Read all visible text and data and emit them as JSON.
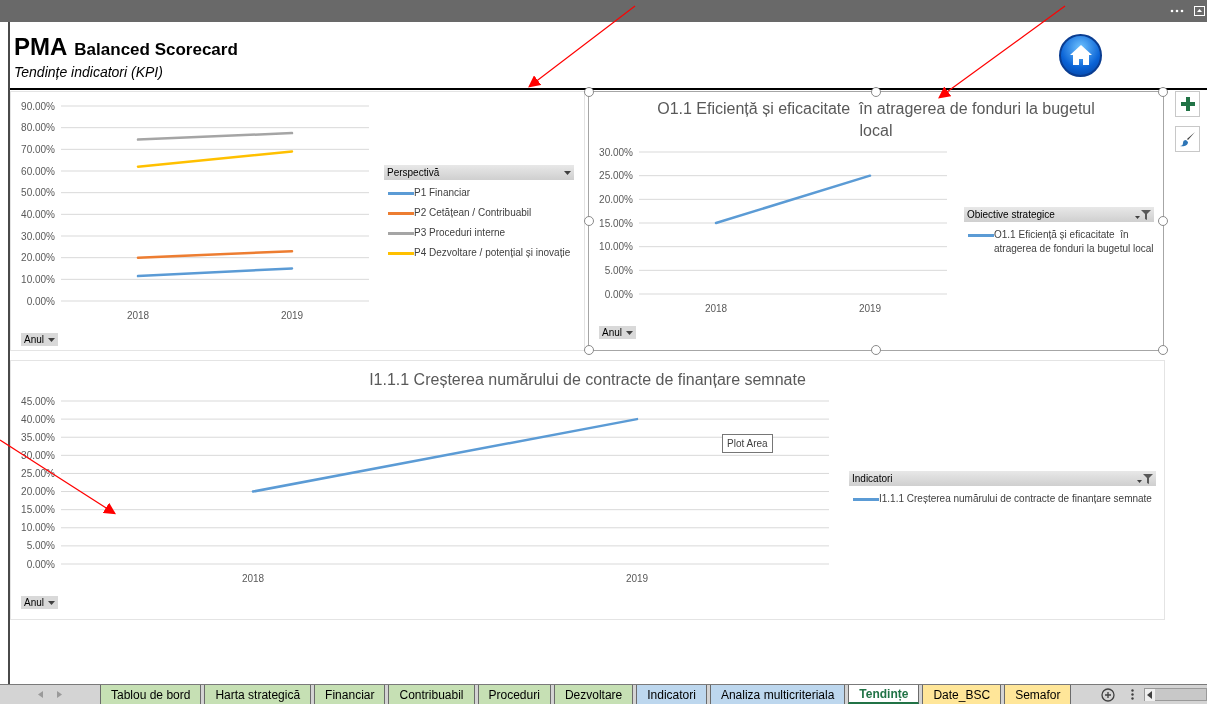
{
  "header": {
    "title": "PMA",
    "subtitle_inline": "Balanced Scorecard",
    "subtitle": "Tendințe indicatori (KPI)"
  },
  "charts": [
    {
      "selected": false,
      "legend": {
        "title": "Perspectivă",
        "filtered": false
      },
      "field_button": "Anul",
      "chart_data": {
        "type": "line",
        "grid": true,
        "categories": [
          "2018",
          "2019"
        ],
        "ylim": [
          0,
          0.9
        ],
        "yticks": [
          {
            "value": 0,
            "label": "0.00%"
          },
          {
            "value": 0.1,
            "label": "10.00%"
          },
          {
            "value": 0.2,
            "label": "20.00%"
          },
          {
            "value": 0.3,
            "label": "30.00%"
          },
          {
            "value": 0.4,
            "label": "40.00%"
          },
          {
            "value": 0.5,
            "label": "50.00%"
          },
          {
            "value": 0.6,
            "label": "60.00%"
          },
          {
            "value": 0.7,
            "label": "70.00%"
          },
          {
            "value": 0.8,
            "label": "80.00%"
          },
          {
            "value": 0.9,
            "label": "90.00%"
          }
        ],
        "series": [
          {
            "name": "P1 Financiar",
            "color": "#5b9bd5",
            "values": [
              0.115,
              0.15
            ]
          },
          {
            "name": "P2 Cetățean / Contribuabil",
            "color": "#ed7d31",
            "values": [
              0.2,
              0.23
            ]
          },
          {
            "name": "P3 Proceduri interne",
            "color": "#a5a5a5",
            "values": [
              0.745,
              0.775
            ]
          },
          {
            "name": "P4 Dezvoltare / potențial și inovație",
            "color": "#ffc000",
            "values": [
              0.62,
              0.69
            ]
          }
        ]
      }
    },
    {
      "selected": true,
      "legend": {
        "title": "Obiective strategice",
        "filtered": true
      },
      "field_button": "Anul",
      "chart_data": {
        "type": "line",
        "grid": true,
        "title": "O1.1 Eficiență și eficacitate  în atragerea de fonduri la bugetul local",
        "categories": [
          "2018",
          "2019"
        ],
        "ylim": [
          0,
          0.3
        ],
        "yticks": [
          {
            "value": 0,
            "label": "0.00%"
          },
          {
            "value": 0.05,
            "label": "5.00%"
          },
          {
            "value": 0.1,
            "label": "10.00%"
          },
          {
            "value": 0.15,
            "label": "15.00%"
          },
          {
            "value": 0.2,
            "label": "20.00%"
          },
          {
            "value": 0.25,
            "label": "25.00%"
          },
          {
            "value": 0.3,
            "label": "30.00%"
          }
        ],
        "series": [
          {
            "name": "O1.1 Eficiență și eficacitate  în atragerea de fonduri la bugetul local",
            "color": "#5b9bd5",
            "values": [
              0.15,
              0.25
            ]
          }
        ]
      }
    },
    {
      "selected": false,
      "legend": {
        "title": "Indicatori",
        "filtered": true
      },
      "field_button": "Anul",
      "tooltip": "Plot Area",
      "chart_data": {
        "type": "line",
        "grid": true,
        "title": "I1.1.1 Creșterea numărului de contracte de finanțare semnate",
        "categories": [
          "2018",
          "2019"
        ],
        "ylim": [
          0,
          0.45
        ],
        "yticks": [
          {
            "value": 0,
            "label": "0.00%"
          },
          {
            "value": 0.05,
            "label": "5.00%"
          },
          {
            "value": 0.1,
            "label": "10.00%"
          },
          {
            "value": 0.15,
            "label": "15.00%"
          },
          {
            "value": 0.2,
            "label": "20.00%"
          },
          {
            "value": 0.25,
            "label": "25.00%"
          },
          {
            "value": 0.3,
            "label": "30.00%"
          },
          {
            "value": 0.35,
            "label": "35.00%"
          },
          {
            "value": 0.4,
            "label": "40.00%"
          },
          {
            "value": 0.45,
            "label": "45.00%"
          }
        ],
        "series": [
          {
            "name": "I1.1.1 Creșterea numărului de contracte de finanțare semnate",
            "color": "#5b9bd5",
            "values": [
              0.2,
              0.4
            ]
          }
        ]
      }
    }
  ],
  "sheet_tabs": [
    {
      "label": "Tablou de bord",
      "selected": false,
      "color": "#c6e0b4"
    },
    {
      "label": "Harta strategică",
      "selected": false,
      "color": "#c6e0b4"
    },
    {
      "label": "Financiar",
      "selected": false,
      "color": "#c6e0b4"
    },
    {
      "label": "Contribuabil",
      "selected": false,
      "color": "#c6e0b4"
    },
    {
      "label": "Proceduri",
      "selected": false,
      "color": "#c6e0b4"
    },
    {
      "label": "Dezvoltare",
      "selected": false,
      "color": "#c6e0b4"
    },
    {
      "label": "Indicatori",
      "selected": false,
      "color": "#bdd7ee"
    },
    {
      "label": "Analiza multicriteriala",
      "selected": false,
      "color": "#bdd7ee"
    },
    {
      "label": "Tendințe",
      "selected": true,
      "color": "#ffffff"
    },
    {
      "label": "Date_BSC",
      "selected": false,
      "color": "#ffe699"
    },
    {
      "label": "Semafor",
      "selected": false,
      "color": "#ffe699"
    }
  ]
}
